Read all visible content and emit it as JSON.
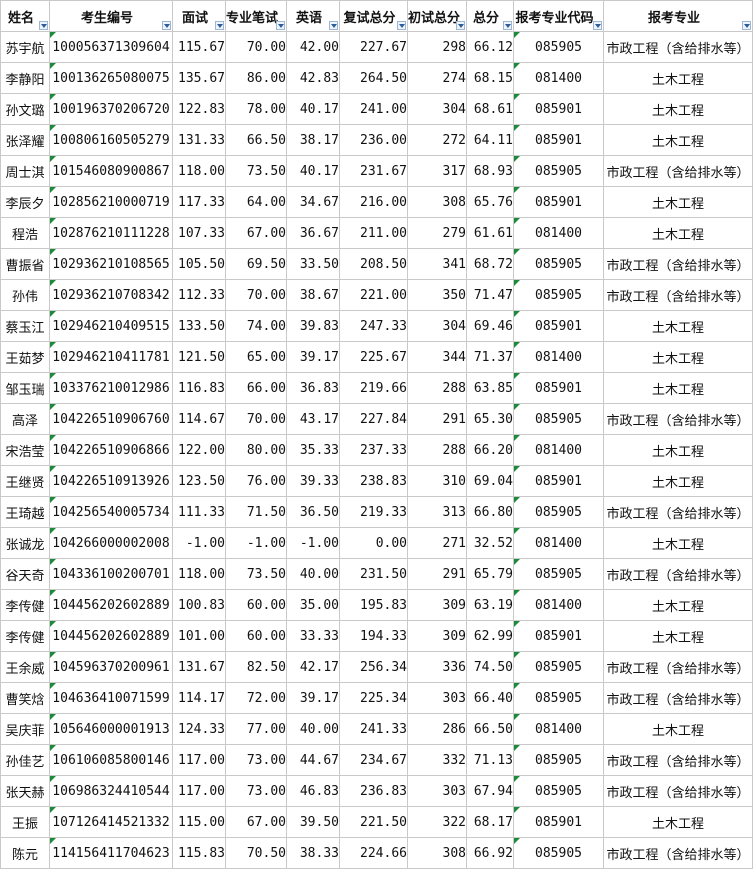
{
  "headers": [
    "姓名",
    "考生编号",
    "面试",
    "专业笔试",
    "英语",
    "复试总分",
    "初试总分",
    "总分",
    "报考专业代码",
    "报考专业"
  ],
  "rows": [
    [
      "苏宇航",
      "100056371309604",
      "115.67",
      "70.00",
      "42.00",
      "227.67",
      "298",
      "66.12",
      "085905",
      "市政工程（含给排水等）"
    ],
    [
      "李静阳",
      "100136265080075",
      "135.67",
      "86.00",
      "42.83",
      "264.50",
      "274",
      "68.15",
      "081400",
      "土木工程"
    ],
    [
      "孙文璐",
      "100196370206720",
      "122.83",
      "78.00",
      "40.17",
      "241.00",
      "304",
      "68.61",
      "085901",
      "土木工程"
    ],
    [
      "张泽耀",
      "100806160505279",
      "131.33",
      "66.50",
      "38.17",
      "236.00",
      "272",
      "64.11",
      "085901",
      "土木工程"
    ],
    [
      "周士淇",
      "101546080900867",
      "118.00",
      "73.50",
      "40.17",
      "231.67",
      "317",
      "68.93",
      "085905",
      "市政工程（含给排水等）"
    ],
    [
      "李辰夕",
      "102856210000719",
      "117.33",
      "64.00",
      "34.67",
      "216.00",
      "308",
      "65.76",
      "085901",
      "土木工程"
    ],
    [
      "程浩",
      "102876210111228",
      "107.33",
      "67.00",
      "36.67",
      "211.00",
      "279",
      "61.61",
      "081400",
      "土木工程"
    ],
    [
      "曹振省",
      "102936210108565",
      "105.50",
      "69.50",
      "33.50",
      "208.50",
      "341",
      "68.72",
      "085905",
      "市政工程（含给排水等）"
    ],
    [
      "孙伟",
      "102936210708342",
      "112.33",
      "70.00",
      "38.67",
      "221.00",
      "350",
      "71.47",
      "085905",
      "市政工程（含给排水等）"
    ],
    [
      "蔡玉江",
      "102946210409515",
      "133.50",
      "74.00",
      "39.83",
      "247.33",
      "304",
      "69.46",
      "085901",
      "土木工程"
    ],
    [
      "王茹梦",
      "102946210411781",
      "121.50",
      "65.00",
      "39.17",
      "225.67",
      "344",
      "71.37",
      "081400",
      "土木工程"
    ],
    [
      "邹玉瑞",
      "103376210012986",
      "116.83",
      "66.00",
      "36.83",
      "219.66",
      "288",
      "63.85",
      "085901",
      "土木工程"
    ],
    [
      "高泽",
      "104226510906760",
      "114.67",
      "70.00",
      "43.17",
      "227.84",
      "291",
      "65.30",
      "085905",
      "市政工程（含给排水等）"
    ],
    [
      "宋浩莹",
      "104226510906866",
      "122.00",
      "80.00",
      "35.33",
      "237.33",
      "288",
      "66.20",
      "081400",
      "土木工程"
    ],
    [
      "王继贤",
      "104226510913926",
      "123.50",
      "76.00",
      "39.33",
      "238.83",
      "310",
      "69.04",
      "085901",
      "土木工程"
    ],
    [
      "王琦越",
      "104256540005734",
      "111.33",
      "71.50",
      "36.50",
      "219.33",
      "313",
      "66.80",
      "085905",
      "市政工程（含给排水等）"
    ],
    [
      "张诚龙",
      "104266000002008",
      "-1.00",
      "-1.00",
      "-1.00",
      "0.00",
      "271",
      "32.52",
      "081400",
      "土木工程"
    ],
    [
      "谷天奇",
      "104336100200701",
      "118.00",
      "73.50",
      "40.00",
      "231.50",
      "291",
      "65.79",
      "085905",
      "市政工程（含给排水等）"
    ],
    [
      "李传健",
      "104456202602889",
      "100.83",
      "60.00",
      "35.00",
      "195.83",
      "309",
      "63.19",
      "081400",
      "土木工程"
    ],
    [
      "李传健",
      "104456202602889",
      "101.00",
      "60.00",
      "33.33",
      "194.33",
      "309",
      "62.99",
      "085901",
      "土木工程"
    ],
    [
      "王余威",
      "104596370200961",
      "131.67",
      "82.50",
      "42.17",
      "256.34",
      "336",
      "74.50",
      "085905",
      "市政工程（含给排水等）"
    ],
    [
      "曹笑焓",
      "104636410071599",
      "114.17",
      "72.00",
      "39.17",
      "225.34",
      "303",
      "66.40",
      "085905",
      "市政工程（含给排水等）"
    ],
    [
      "吴庆菲",
      "105646000001913",
      "124.33",
      "77.00",
      "40.00",
      "241.33",
      "286",
      "66.50",
      "081400",
      "土木工程"
    ],
    [
      "孙佳艺",
      "106106085800146",
      "117.00",
      "73.00",
      "44.67",
      "234.67",
      "332",
      "71.13",
      "085905",
      "市政工程（含给排水等）"
    ],
    [
      "张天赫",
      "106986324410544",
      "117.00",
      "73.00",
      "46.83",
      "236.83",
      "303",
      "67.94",
      "085905",
      "市政工程（含给排水等）"
    ],
    [
      "王振",
      "107126414521332",
      "115.00",
      "67.00",
      "39.50",
      "221.50",
      "322",
      "68.17",
      "085901",
      "土木工程"
    ],
    [
      "陈元",
      "114156411704623",
      "115.83",
      "70.50",
      "38.33",
      "224.66",
      "308",
      "66.92",
      "085905",
      "市政工程（含给排水等）"
    ]
  ]
}
